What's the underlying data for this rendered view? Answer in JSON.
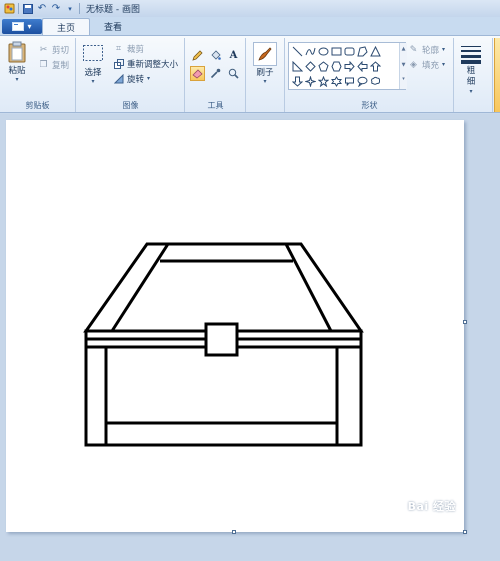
{
  "window": {
    "title": "无标题 - 画图"
  },
  "tabs": [
    {
      "label": "主页",
      "active": true
    },
    {
      "label": "查看",
      "active": false
    }
  ],
  "clipboard": {
    "group_label": "剪贴板",
    "paste_label": "粘贴",
    "cut_label": "剪切",
    "copy_label": "复制"
  },
  "image": {
    "group_label": "图像",
    "select_label": "选择",
    "crop_label": "裁剪",
    "resize_label": "重新调整大小",
    "rotate_label": "旋转"
  },
  "tools": {
    "group_label": "工具",
    "items": [
      "pencil-icon",
      "fill-icon",
      "text-icon",
      "eraser-icon",
      "color-picker-icon",
      "magnifier-icon"
    ],
    "text_glyph": "A",
    "active": "eraser-icon"
  },
  "brushes": {
    "label": "刷子"
  },
  "shapes": {
    "group_label": "形状",
    "outline_label": "轮廓",
    "fill_label": "填充"
  },
  "size": {
    "label": "粗细"
  },
  "watermark": {
    "text": "Bai 经验"
  },
  "colors": {
    "active_tool": "#f7c65c",
    "ribbon": "#dfeaf7",
    "workspace": "#c6d6e9",
    "canvas": "#ffffff"
  }
}
